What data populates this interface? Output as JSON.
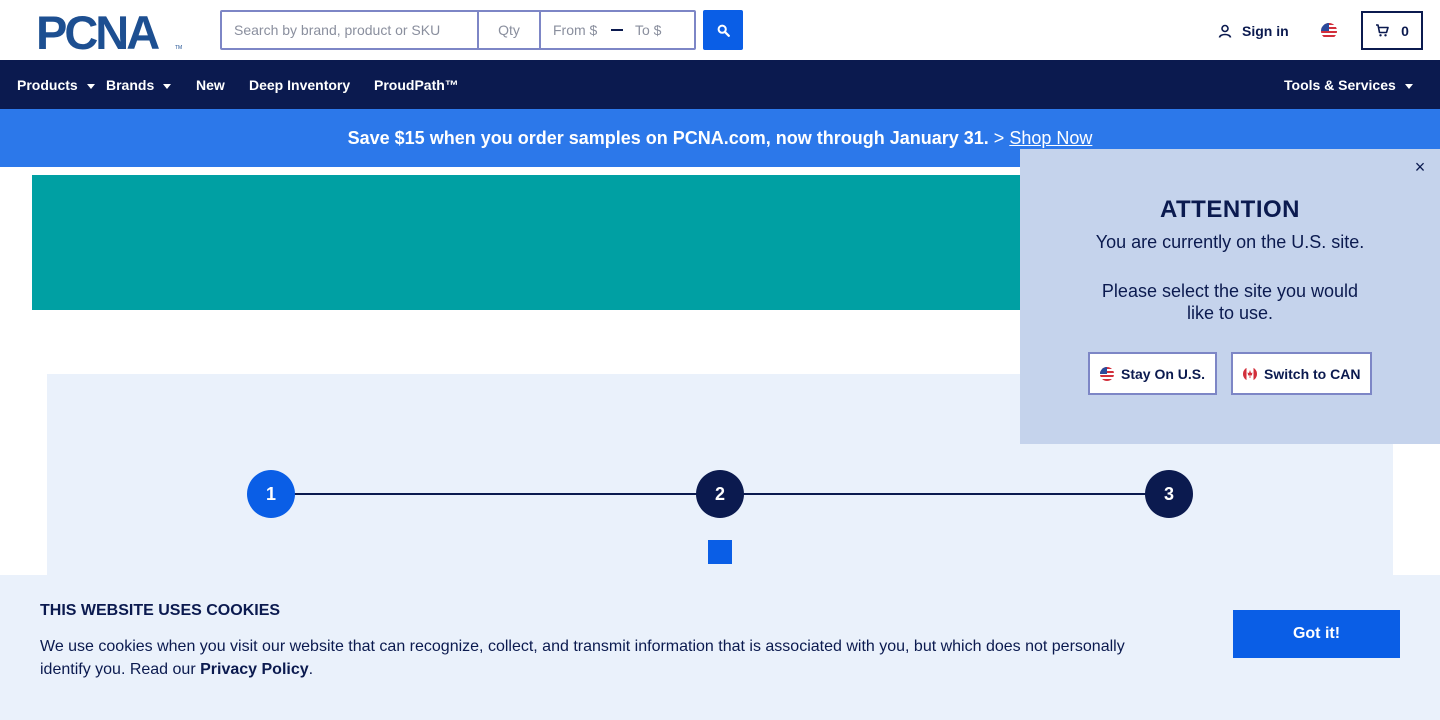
{
  "header": {
    "logo_text": "PCNA",
    "search_placeholder": "Search by brand, product or SKU",
    "qty_placeholder": "Qty",
    "price_from_placeholder": "From $",
    "price_to_placeholder": "To $",
    "sign_in_label": "Sign in",
    "cart_count": "0"
  },
  "nav": {
    "items": [
      {
        "label": "Products",
        "has_dropdown": true
      },
      {
        "label": "Brands",
        "has_dropdown": true
      },
      {
        "label": "New",
        "has_dropdown": false
      },
      {
        "label": "Deep Inventory",
        "has_dropdown": false
      },
      {
        "label": "ProudPath™",
        "has_dropdown": false
      }
    ],
    "right_item": {
      "label": "Tools & Services",
      "has_dropdown": true
    }
  },
  "promo": {
    "text": "Save $15 when you order samples on PCNA.com, now through January 31.",
    "separator": ">",
    "link_label": "Shop Now"
  },
  "steps": [
    "1",
    "2",
    "3"
  ],
  "popup": {
    "close_glyph": "×",
    "title": "ATTENTION",
    "line1": "You are currently on the U.S. site.",
    "line2": "Please select the site you would",
    "line3": "like to use.",
    "stay_label": "Stay On U.S.",
    "switch_label": "Switch to CAN"
  },
  "cookies": {
    "title": "THIS WEBSITE USES COOKIES",
    "text": "We use cookies when you visit our website that can recognize, collect, and transmit information that is associated with you, but which does not personally identify you. Read our",
    "link_label": "Privacy Policy",
    "end": ".",
    "button_label": "Got it!"
  },
  "colors": {
    "navy": "#0b1a4f",
    "accent_blue": "#0a5ee6",
    "promo_blue": "#2c78ea",
    "teal": "#00a0a3",
    "light_panel": "#eaf1fb",
    "popup_bg": "#c5d3ec"
  },
  "icons": {
    "search": "search-icon",
    "user": "user-icon",
    "flag": "us-flag-icon",
    "cart": "cart-icon",
    "close": "close-icon"
  }
}
